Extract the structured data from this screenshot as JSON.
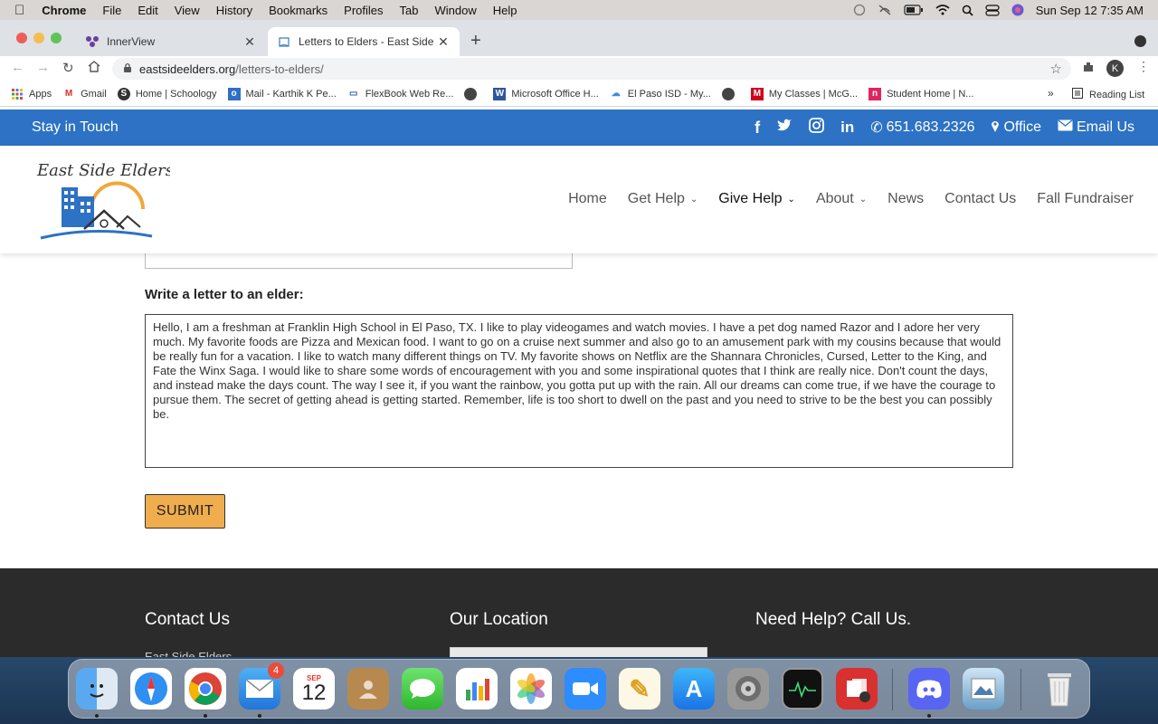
{
  "menubar": {
    "app": "Chrome",
    "items": [
      "File",
      "Edit",
      "View",
      "History",
      "Bookmarks",
      "Profiles",
      "Tab",
      "Window",
      "Help"
    ],
    "datetime": "Sun Sep 12  7:35 AM"
  },
  "tabs": [
    {
      "title": "InnerView",
      "active": false
    },
    {
      "title": "Letters to Elders - East Side Elders",
      "active": true
    }
  ],
  "address": {
    "host": "eastsideelders.org",
    "path": "/letters-to-elders/"
  },
  "profile_initial": "K",
  "bookmarks": [
    {
      "label": "Apps",
      "icon": "apps-grid-icon"
    },
    {
      "label": "Gmail",
      "icon": "gmail-icon"
    },
    {
      "label": "Home | Schoology",
      "icon": "schoology-icon"
    },
    {
      "label": "Mail - Karthik K Pe...",
      "icon": "outlook-icon"
    },
    {
      "label": "FlexBook Web Re...",
      "icon": "flexbook-icon"
    },
    {
      "label": "",
      "icon": "globe-icon"
    },
    {
      "label": "Microsoft Office H...",
      "icon": "word-icon"
    },
    {
      "label": "El Paso ISD - My...",
      "icon": "cloud-icon"
    },
    {
      "label": "",
      "icon": "globe-icon"
    },
    {
      "label": "My Classes | McG...",
      "icon": "mcgraw-icon"
    },
    {
      "label": "Student Home | N...",
      "icon": "student-icon"
    }
  ],
  "reading_list": "Reading List",
  "site": {
    "topbar": {
      "stay": "Stay in Touch",
      "phone": "651.683.2326",
      "office": "Office",
      "email": "Email Us"
    },
    "logo_text": "East Side Elders",
    "nav": [
      {
        "label": "Home",
        "dropdown": false,
        "active": false
      },
      {
        "label": "Get Help",
        "dropdown": true,
        "active": false
      },
      {
        "label": "Give Help",
        "dropdown": true,
        "active": true
      },
      {
        "label": "About",
        "dropdown": true,
        "active": false
      },
      {
        "label": "News",
        "dropdown": false,
        "active": false
      },
      {
        "label": "Contact Us",
        "dropdown": false,
        "active": false
      },
      {
        "label": "Fall Fundraiser",
        "dropdown": false,
        "active": false
      }
    ],
    "form": {
      "letter_label": "Write a letter to an elder:",
      "letter_value": "Hello, I am a freshman at Franklin High School in El Paso, TX. I like to play videogames and watch movies. I have a pet dog named Razor and I adore her very much. My favorite foods are Pizza and Mexican food. I want to go on a cruise next summer and also go to an amusement park with my cousins because that would be really fun for a vacation. I like to watch many different things on TV. My favorite shows on Netflix are the Shannara Chronicles, Cursed, Letter to the King, and Fate the Winx Saga. I would like to share some words of encouragement with you and some inspirational quotes that I think are really nice. Don't count the days, and instead make the days count. The way I see it, if you want the rainbow, you gotta put up with the rain. All our dreams can come true, if we have the courage to pursue them. The secret of getting ahead is getting started. Remember, life is too short to dwell on the past and you need to strive to be the best you can possibly be.",
      "submit_label": "SUBMIT"
    },
    "footer": {
      "col1": "Contact Us",
      "col2": "Our Location",
      "col3": "Need Help?  Call Us.",
      "col1_sub": "East Side Elders"
    }
  },
  "dock": {
    "mail_badge": "4",
    "calendar_month": "SEP",
    "calendar_day": "12"
  },
  "colors": {
    "topbar": "#2d72c4",
    "submit": "#f0ad4e",
    "footer": "#2b2b2b"
  }
}
